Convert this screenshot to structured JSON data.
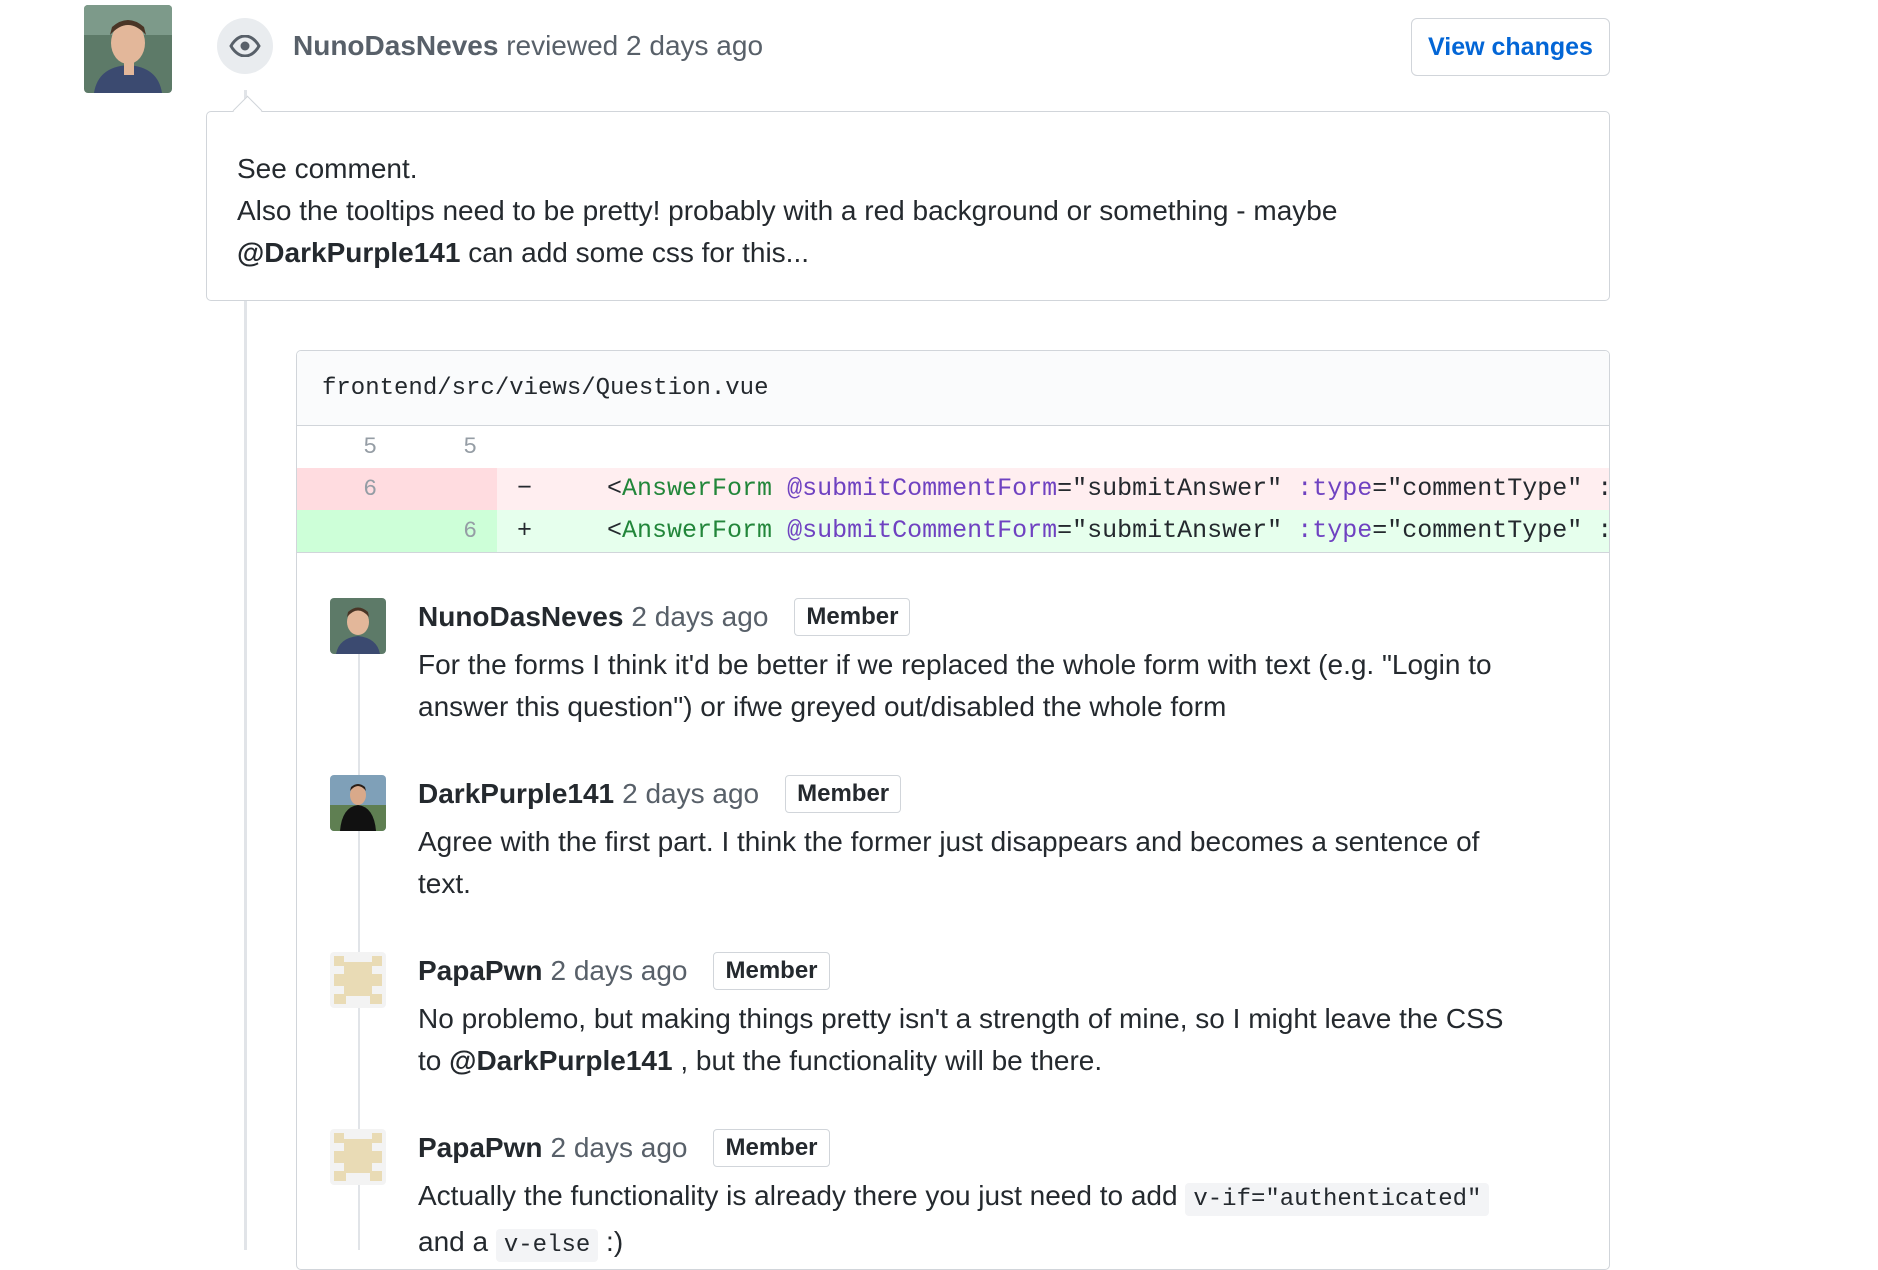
{
  "review": {
    "author": "NunoDasNeves",
    "action": "reviewed",
    "time": "2 days ago",
    "view_changes_label": "View changes",
    "body": {
      "line1": "See comment.",
      "line2": "Also the tooltips need to be pretty! probably with a red background or something - maybe",
      "mention": "@DarkPurple141",
      "line3_rest": " can add some css for this..."
    }
  },
  "diff": {
    "file_path": "frontend/src/views/Question.vue",
    "rows": [
      {
        "old": "5",
        "new": "5",
        "sign": "",
        "type": "context"
      },
      {
        "old": "6",
        "new": "",
        "sign": "−",
        "type": "deletion"
      },
      {
        "old": "",
        "new": "6",
        "sign": "+",
        "type": "addition"
      }
    ],
    "code_tokens": {
      "open": "<",
      "tag": "AnswerForm",
      "attr1": "@submitCommentForm",
      "eq1": "=",
      "val1": "\"submitAnswer\"",
      "attr2": ":type",
      "eq2": "=",
      "val2": "\"commentType\"",
      "tail": " :"
    }
  },
  "comments": [
    {
      "author": "NunoDasNeves",
      "time": "2 days ago",
      "badge": "Member",
      "line1": "For the forms I think it'd be better if we replaced the whole form with text (e.g. \"Login to",
      "line2": "answer this question\") or ifwe greyed out/disabled the whole form"
    },
    {
      "author": "DarkPurple141",
      "time": "2 days ago",
      "badge": "Member",
      "line1": "Agree with the first part. I think the former just disappears and becomes a sentence of",
      "line2": "text."
    },
    {
      "author": "PapaPwn",
      "time": "2 days ago",
      "badge": "Member",
      "line1": "No problemo, but making things pretty isn't a strength of mine, so I might leave the CSS",
      "line2_pre": "to ",
      "line2_mention": "@DarkPurple141",
      "line2_post": " , but the functionality will be there."
    },
    {
      "author": "PapaPwn",
      "time": "2 days ago",
      "badge": "Member",
      "line1_pre": "Actually the functionality is already there you just need to add ",
      "line1_code": "v-if=\"authenticated\"",
      "line2_pre": "and a ",
      "line2_code": "v-else",
      "line2_post": " :)"
    }
  ],
  "colors": {
    "link": "#0366d6",
    "deletion_bg": "#ffeef0",
    "addition_bg": "#e6ffed",
    "tag_green": "#22863a",
    "attr_purple": "#6f42c1"
  }
}
